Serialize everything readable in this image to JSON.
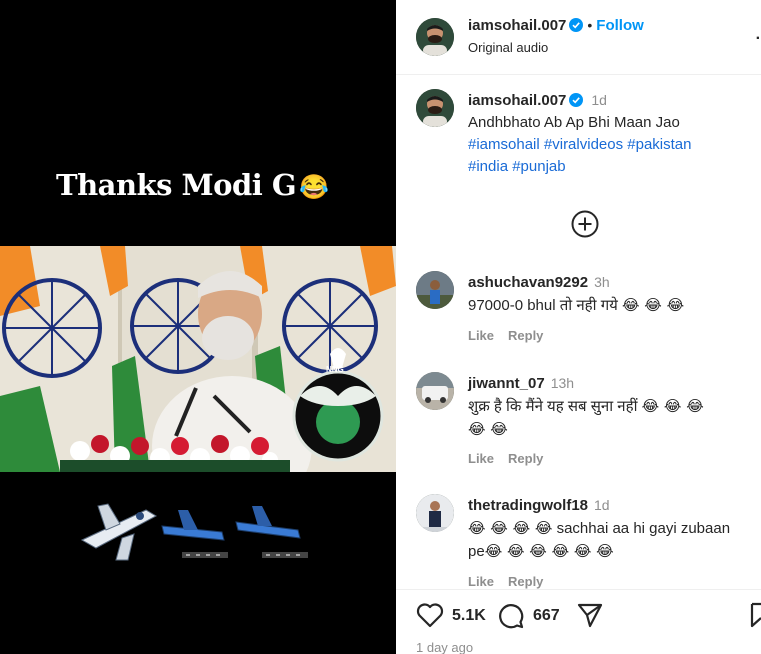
{
  "media": {
    "overlay_text": "Thanks Modi G",
    "overlay_emoji": "😂",
    "watermark": "NNG"
  },
  "header": {
    "username": "iamsohail.007",
    "follow_label": "Follow",
    "audio_label": "Original audio",
    "more_label": "·"
  },
  "caption": {
    "username": "iamsohail.007",
    "time": "1d",
    "text": "Andhbhato Ab Ap Bhi Maan Jao",
    "hashtags": [
      "#iamsohail",
      "#viralvideos",
      "#pakistan",
      "#india",
      "#punjab"
    ]
  },
  "comments": [
    {
      "username": "ashuchavan9292",
      "time": "3h",
      "text": "97000-0 bhul तो नही गये",
      "emojis": "😂 😂 😂",
      "like_label": "Like",
      "reply_label": "Reply"
    },
    {
      "username": "jiwannt_07",
      "time": "13h",
      "text": "शुक्र है कि मैंने यह सब सुना नहीं",
      "emojis": "😂 😂 😂",
      "emojis_line2": "😂 😂",
      "like_label": "Like",
      "reply_label": "Reply"
    },
    {
      "username": "thetradingwolf18",
      "time": "1d",
      "emojis_lead": "😂 😂 😂 😂",
      "text": "sachhai aa hi gayi zubaan",
      "text_line2": "pe",
      "emojis_tail": "😂 😂 😂 😂 😂 😂",
      "like_label": "Like",
      "reply_label": "Reply"
    }
  ],
  "footer": {
    "likes": "5.1K",
    "comments": "667",
    "ago": "1 day ago"
  },
  "colors": {
    "accent": "#0095f6",
    "hashtag": "#1a6bd6",
    "muted": "#8e8e8e",
    "verified": "#0095f6"
  }
}
